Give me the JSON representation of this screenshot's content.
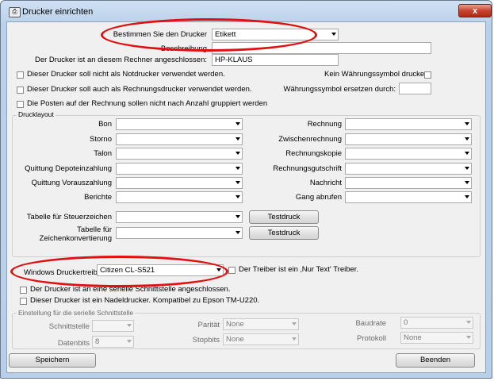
{
  "window": {
    "title": "Drucker einrichten",
    "close_label": "x"
  },
  "printer_select": {
    "label": "Bestimmen Sie den Drucker",
    "value": "Etikett"
  },
  "description": {
    "label": "Beschreibung",
    "value": ""
  },
  "connected_to": {
    "label": "Der Drucker ist an diesem Rechner angeschlossen:",
    "value": "HP-KLAUS"
  },
  "options": {
    "not_emergency": "Dieser Drucker soll nicht als Notdrucker verwendet werden.",
    "invoice_printer": "Dieser Drucker soll auch als Rechnungsdrucker verwendet werden.",
    "no_group": "Die Posten auf der Rechnung sollen nicht nach Anzahl gruppiert werden",
    "no_currency": "Kein Währungssymbol drucken",
    "replace_currency_label": "Währungssymbol ersetzen durch:",
    "replace_currency_value": ""
  },
  "layout": {
    "title": "Drucklayout",
    "left": [
      "Bon",
      "Storno",
      "Talon",
      "Quittung Depoteinzahlung",
      "Quittung Vorauszahlung",
      "Berichte"
    ],
    "right": [
      "Rechnung",
      "Zwischenrechnung",
      "Rechnungskopie",
      "Rechnungsgutschrift",
      "Nachricht",
      "Gang abrufen"
    ],
    "tax_table": "Tabelle für Steuerzeichen",
    "char_table_1": "Tabelle für",
    "char_table_2": "Zeichenkonvertierung",
    "test_print": "Testdruck"
  },
  "driver": {
    "label": "Windows Druckertreiber",
    "value": "Citizen CL-S521",
    "text_only": "Der Treiber ist ein ‚Nur Text' Treiber.",
    "serial_visible": "Der Drucker ist an eine serielle Schnittstelle angeschlossen.",
    "needle": "Dieser Drucker ist ein Nadeldrucker. Kompatibel zu Epson TM-U220."
  },
  "serial": {
    "title": "Einstellung für die serielle Schnittstelle",
    "port_label": "Schnittstelle",
    "port_value": "",
    "databits_label": "Datenbits",
    "databits_value": "8",
    "parity_label": "Parität",
    "parity_value": "None",
    "stopbits_label": "Stopbits",
    "stopbits_value": "None",
    "baud_label": "Baudrate",
    "baud_value": "0",
    "protocol_label": "Protokoll",
    "protocol_value": "None"
  },
  "footer": {
    "save": "Speichern",
    "exit": "Beenden"
  },
  "colors": {
    "annotation": "#e01010",
    "title_bar": "#b9d1ea",
    "close_button": "#c7442d"
  }
}
